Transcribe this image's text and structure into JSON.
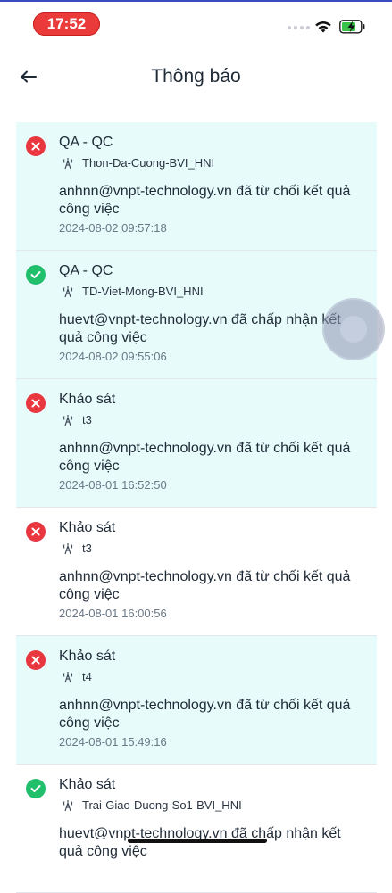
{
  "status_bar": {
    "time": "17:52"
  },
  "header": {
    "title": "Thông báo"
  },
  "notifications": [
    {
      "status": "rejected",
      "title": "QA - QC",
      "site": "Thon-Da-Cuong-BVI_HNI",
      "message": "anhnn@vnpt-technology.vn đã từ chối kết quả công việc",
      "timestamp": "2024-08-02 09:57:18",
      "unread": true
    },
    {
      "status": "accepted",
      "title": "QA - QC",
      "site": "TD-Viet-Mong-BVI_HNI",
      "message": "huevt@vnpt-technology.vn đã chấp nhận kết quả công việc",
      "timestamp": "2024-08-02 09:55:06",
      "unread": true
    },
    {
      "status": "rejected",
      "title": "Khảo sát",
      "site": "t3",
      "message": "anhnn@vnpt-technology.vn đã từ chối kết quả công việc",
      "timestamp": "2024-08-01 16:52:50",
      "unread": true
    },
    {
      "status": "rejected",
      "title": "Khảo sát",
      "site": "t3",
      "message": "anhnn@vnpt-technology.vn đã từ chối kết quả công việc",
      "timestamp": "2024-08-01 16:00:56",
      "unread": false
    },
    {
      "status": "rejected",
      "title": "Khảo sát",
      "site": "t4",
      "message": "anhnn@vnpt-technology.vn đã từ chối kết quả công việc",
      "timestamp": "2024-08-01 15:49:16",
      "unread": true
    },
    {
      "status": "accepted",
      "title": "Khảo sát",
      "site": "Trai-Giao-Duong-So1-BVI_HNI",
      "message": "huevt@vnpt-technology.vn đã chấp nhận kết quả công việc",
      "timestamp": "",
      "unread": false
    }
  ],
  "colors": {
    "unread_bg": "#e8fbfb",
    "rejected": "#e8373f",
    "accepted": "#1fbf6c",
    "time_pill": "#ea3a3a"
  }
}
